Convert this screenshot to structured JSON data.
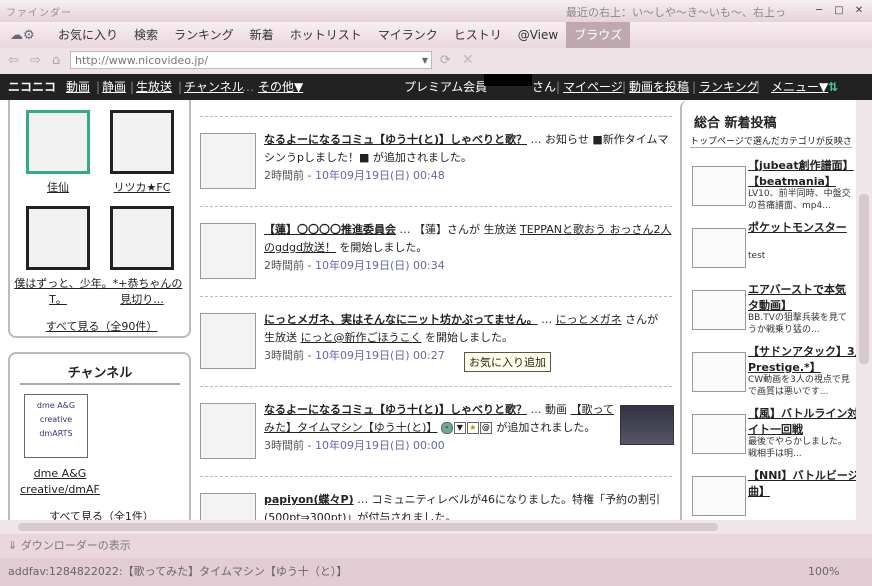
{
  "window": {
    "app_title": "ファインダー",
    "info_text": "最近の右上：い～しや～き～いも～、右上っ"
  },
  "menu": [
    "お気に入り",
    "検索",
    "ランキング",
    "新着",
    "ホットリスト",
    "マイランク",
    "ヒストリ",
    "@View",
    "ブラウズ"
  ],
  "active_menu": "ブラウズ",
  "address": {
    "url": "http://www.nicovideo.jp/"
  },
  "nico": {
    "logo": "ニコニコ",
    "links": [
      "動画",
      "静画",
      "生放送",
      "チャンネル"
    ],
    "other": "その他▼",
    "member": "プレミアム会員",
    "san": "さん",
    "mypage": "マイページ",
    "upload": "動画を投稿",
    "ranking": "ランキング",
    "menu": "メニュー▼"
  },
  "community": {
    "items": [
      {
        "name": "佳仙"
      },
      {
        "name": "リツカ★FC"
      },
      {
        "name": "僕はずっと、少年T。"
      },
      {
        "name": "。*+恭ちゃんの見切り..."
      }
    ],
    "see_all": "すべて見る（全90件）"
  },
  "channel": {
    "title": "チャンネル",
    "items": [
      {
        "name": "dme A&G creative/dmAF",
        "logo_text": "dme A&G creative dmARTS"
      }
    ],
    "see_all": "すべて見る（全1件）"
  },
  "feed": [
    {
      "title": "なるよーになるコミュ【ゆう十(と)】しゃべりと歌？",
      "t1": " … お知らせ ■新作タイムマシンうpしました！■ が追加されました。",
      "time": "2時間前",
      "date": "10年09月19日(日) 00:48"
    },
    {
      "title": "【蓮】〇〇〇〇推進委員会",
      "t1": " … 【蓮】さんが 生放送 ",
      "link": "TEPPANと歌おう おっさん2人のgdgd放送！",
      "t2": " を開始しました。",
      "time": "2時間前",
      "date": "10年09月19日(日) 00:34"
    },
    {
      "title": "にっとメガネ、実はそんなにニット坊かぶってません。",
      "t1": " … ",
      "link0": "にっとメガネ",
      "t1b": " さんが 生放送 ",
      "link": "にっと@新作ごほうこく",
      "t2": " を開始しました。",
      "time": "3時間前",
      "date": "10年09月19日(日) 00:27"
    },
    {
      "title": "なるよーになるコミュ【ゆう十(と)】しゃべりと歌？",
      "t1": " … 動画 ",
      "link": "【歌ってみた】タイムマシン【ゆう十(と)】",
      "t2": " が追加されました。",
      "time": "3時間前",
      "date": "10年09月19日(日) 00:00"
    },
    {
      "title": "papiyon(蝶々P)",
      "t1": " … コミュニティレベルが46になりました。特権「予約の割引(500pt⇒300pt)」が付与されました。",
      "time": "",
      "date": ""
    }
  ],
  "tooltip": "お気に入り追加",
  "ranking": {
    "title": "総合 新着投稿",
    "subtitle": "トップページで選んだカテゴリが反映さ",
    "items": [
      {
        "t1": "【jubeat創作譜面】",
        "t2": "【beatmania】",
        "desc1": "LV10、前半同時、中盤交",
        "desc2": "の苔痛譜面、mp4..."
      },
      {
        "t1": "ポケットモンスター",
        "t2": "",
        "desc1": "test",
        "desc2": ""
      },
      {
        "t1": "エアバーストで本気",
        "t2": "タ動画】",
        "desc1": "BB.TVの狙撃兵装を見て",
        "desc2": "うか戦乗り猛の..."
      },
      {
        "t1": "【サドンアタック】3人",
        "t2": "Prestige.*】",
        "desc1": "CW動画を3人の視点で見",
        "desc2": "で画質は悪いです..."
      },
      {
        "t1": "【風】バトルライン対",
        "t2": "イト一回戦",
        "desc1": "最後でやらかしました。",
        "desc2": "戦相手は明..."
      },
      {
        "t1": "【NNI】バトルビージ",
        "t2": "曲】",
        "desc1": "",
        "desc2": ""
      }
    ]
  },
  "downloader": "ダウンローダーの表示",
  "status": {
    "text": "addfav:1284822022:【歌ってみた】タイムマシン【ゆう十（と）】",
    "zoom": "100%"
  }
}
